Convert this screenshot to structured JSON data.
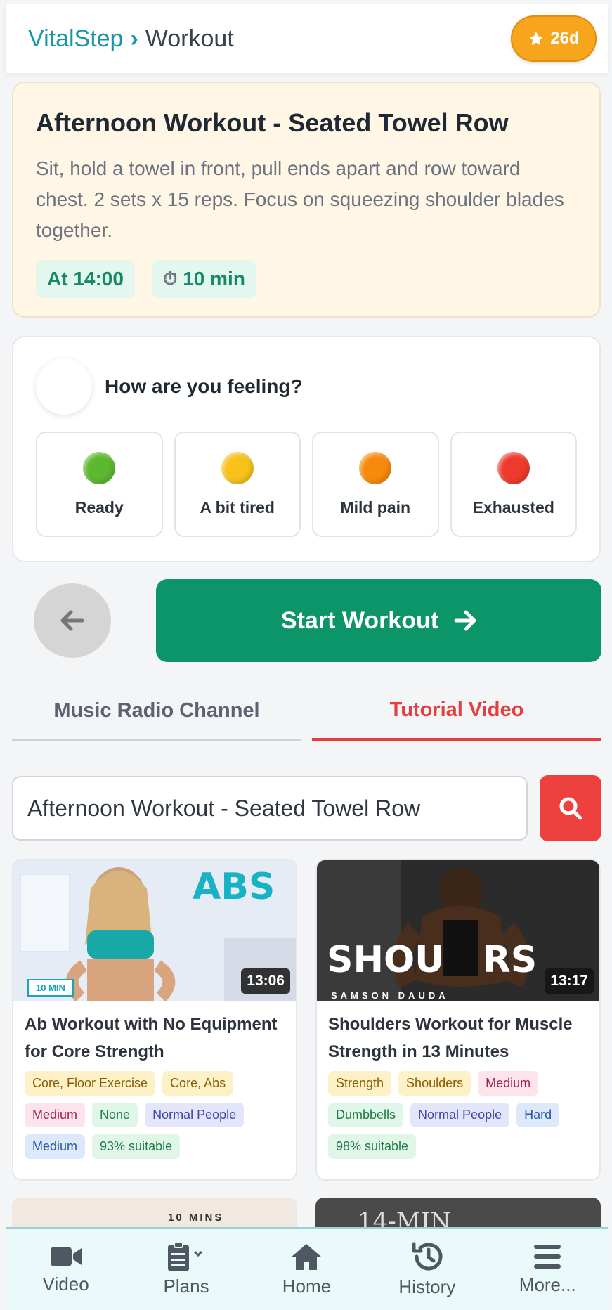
{
  "header": {
    "app_name": "VitalStep",
    "separator": "›",
    "page": "Workout",
    "streak": "26d"
  },
  "workout": {
    "title": "Afternoon Workout - Seated Towel Row",
    "description": "Sit, hold a towel in front, pull ends apart and row toward chest. 2 sets x 15 reps. Focus on squeezing shoulder blades together.",
    "time": "At 14:00",
    "duration": "10 min"
  },
  "feeling": {
    "question": "How are you feeling?",
    "options": [
      {
        "label": "Ready",
        "color": "#5cb82f"
      },
      {
        "label": "A bit tired",
        "color": "#f8c21b"
      },
      {
        "label": "Mild pain",
        "color": "#f78a0c"
      },
      {
        "label": "Exhausted",
        "color": "#ee3a2c"
      }
    ]
  },
  "actions": {
    "start_label": "Start Workout"
  },
  "tabs": [
    {
      "label": "Music Radio Channel",
      "active": false
    },
    {
      "label": "Tutorial Video",
      "active": true
    }
  ],
  "search": {
    "value": "Afternoon Workout - Seated Towel Row"
  },
  "videos": [
    {
      "title": "Ab Workout with No Equipment for Core Strength",
      "duration": "13:06",
      "thumb_text": "ABS",
      "thumb_badge": "10 MIN",
      "tags": [
        {
          "text": "Core, Floor Exercise",
          "style": "yellow"
        },
        {
          "text": "Core, Abs",
          "style": "yellow"
        },
        {
          "text": "Medium",
          "style": "pink"
        },
        {
          "text": "None",
          "style": "green"
        },
        {
          "text": "Normal People",
          "style": "indigo"
        },
        {
          "text": "Medium",
          "style": "blue"
        },
        {
          "text": "93% suitable",
          "style": "green"
        }
      ]
    },
    {
      "title": "Shoulders Workout for Muscle Strength in 13 Minutes",
      "duration": "13:17",
      "thumb_text": "SHOU   RS",
      "thumb_badge": "SAMSON DAUDA",
      "tags": [
        {
          "text": "Strength",
          "style": "yellow"
        },
        {
          "text": "Shoulders",
          "style": "yellow"
        },
        {
          "text": "Medium",
          "style": "pink"
        },
        {
          "text": "Dumbbells",
          "style": "green"
        },
        {
          "text": "Normal People",
          "style": "indigo"
        },
        {
          "text": "Hard",
          "style": "blue"
        },
        {
          "text": "98% suitable",
          "style": "green"
        }
      ]
    }
  ],
  "peek": {
    "left_text": "10 MINS",
    "right_text": "14-MIN"
  },
  "nav": [
    {
      "label": "Video",
      "icon": "video-camera-icon"
    },
    {
      "label": "Plans",
      "icon": "clipboard-list-icon"
    },
    {
      "label": "Home",
      "icon": "home-icon"
    },
    {
      "label": "History",
      "icon": "history-icon"
    },
    {
      "label": "More...",
      "icon": "menu-icon"
    }
  ]
}
